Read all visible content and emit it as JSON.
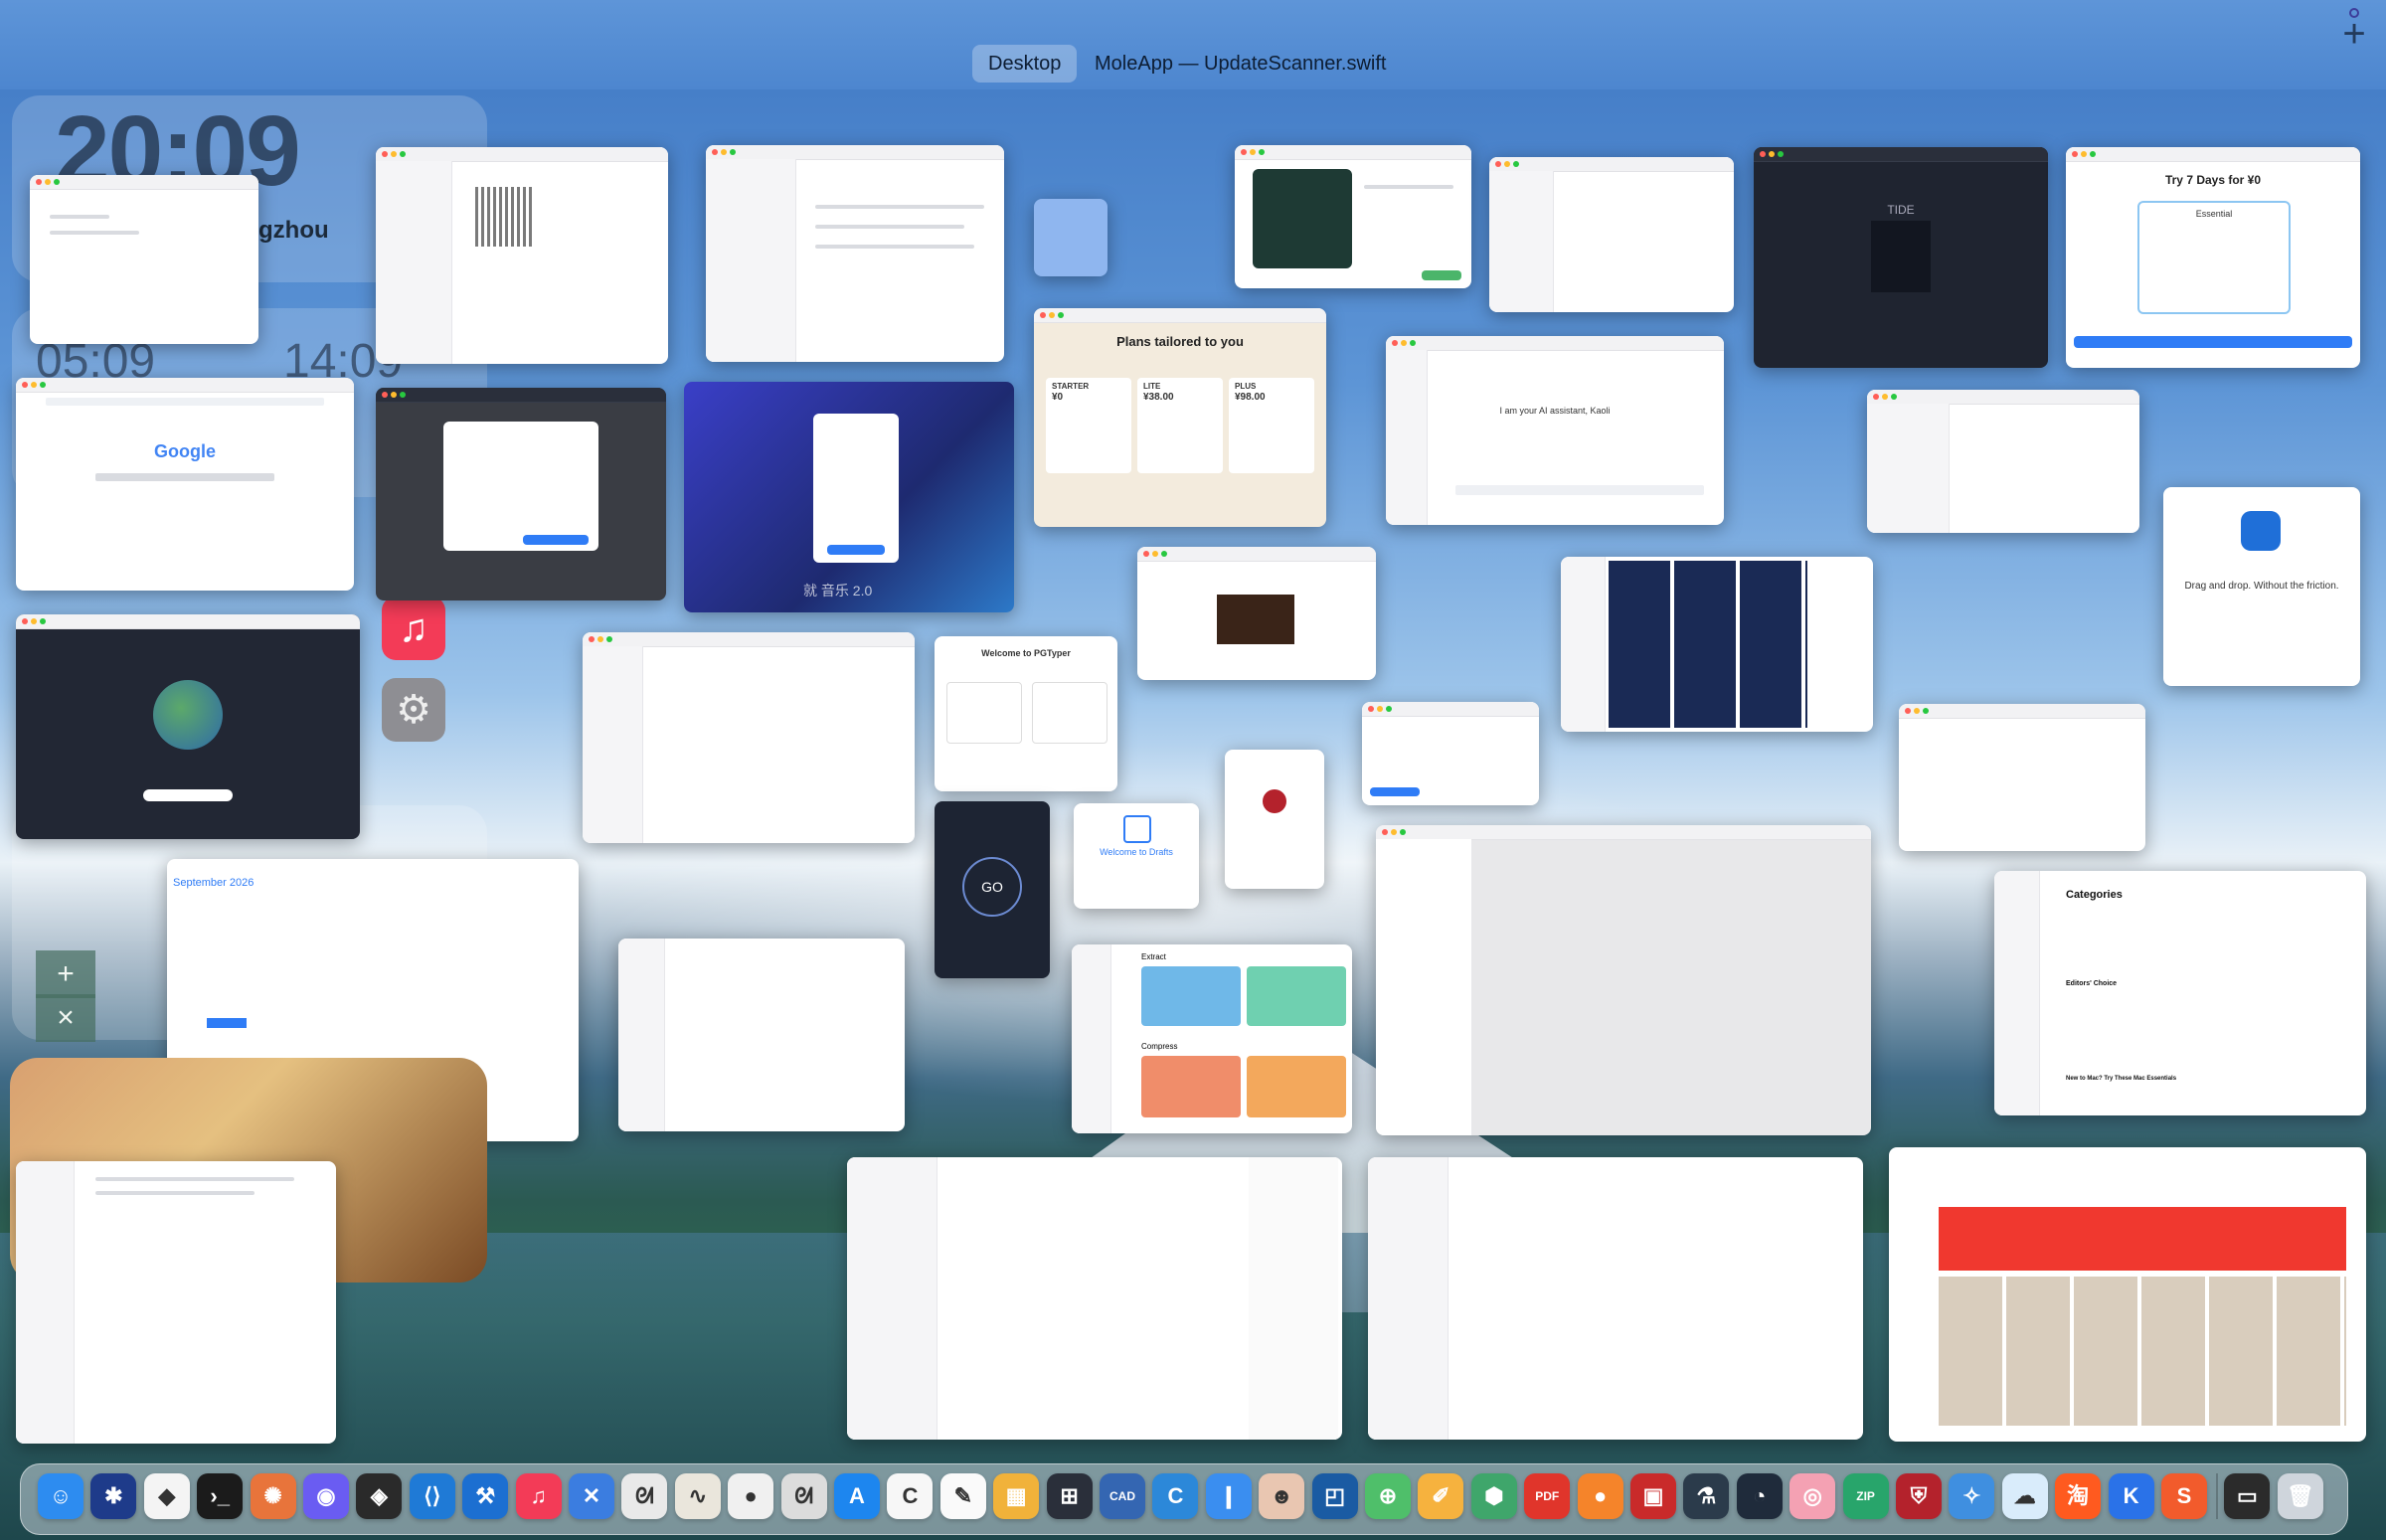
{
  "topbar": {
    "spaces": [
      "Desktop",
      "MoleApp — UpdateScanner.swift"
    ],
    "add_space_label": "+"
  },
  "widgets": {
    "clock_time": "20:09",
    "clock_city": "gzhou",
    "world_clock_1": "05:09",
    "world_clock_2": "14:09",
    "calculator_keys": [
      "+",
      "×"
    ]
  },
  "windows": {
    "google": {
      "logo_text": "Google"
    },
    "plans": {
      "title": "Plans tailored to you",
      "tiers": [
        "STARTER",
        "LITE",
        "PLUS"
      ],
      "prices": [
        "¥0",
        "¥38.00",
        "¥98.00"
      ]
    },
    "trial": {
      "title": "Try 7 Days for ¥0",
      "plan": "Essential"
    },
    "tide": {
      "title": "TIDE"
    },
    "dragdrop": {
      "title": "Drag and drop. Without the friction."
    },
    "assistant": {
      "greeting": "I am your AI assistant, Kaoli"
    },
    "postgres": {
      "title": "Welcome to PGTyper"
    },
    "drafts": {
      "title": "Welcome to Drafts"
    },
    "vpn": {
      "button": "GO"
    },
    "calendar": {
      "month": "September 2026"
    },
    "categories": {
      "title": "Categories",
      "section_1": "Editors' Choice",
      "section_2": "New to Mac? Try These Mac Essentials"
    },
    "compress": {
      "section_1": "Extract",
      "section_2": "Compress"
    },
    "music_logo": "就 音乐 2.0"
  },
  "dock": {
    "icons": [
      {
        "name": "finder-icon",
        "color": "#2d8cf0",
        "glyph": "☺"
      },
      {
        "name": "asterisk-icon",
        "color": "#1e3b8a",
        "glyph": "✱"
      },
      {
        "name": "cardinal-icon",
        "color": "#f4f4f4",
        "glyph": "◆"
      },
      {
        "name": "terminal-icon",
        "color": "#1b1b1b",
        "glyph": "›_"
      },
      {
        "name": "claude-icon",
        "color": "#e8743b",
        "glyph": "✺"
      },
      {
        "name": "chat-icon",
        "color": "#6a5cf2",
        "glyph": "◉"
      },
      {
        "name": "cube-icon",
        "color": "#2a2a2a",
        "glyph": "◈"
      },
      {
        "name": "vscode-icon",
        "color": "#1f7ad6",
        "glyph": "⟨⟩"
      },
      {
        "name": "xcode-icon",
        "color": "#1c6fd1",
        "glyph": "⚒"
      },
      {
        "name": "music-icon",
        "color": "#f33b57",
        "glyph": "♫"
      },
      {
        "name": "xcode-tools-icon",
        "color": "#3b7de0",
        "glyph": "✕"
      },
      {
        "name": "rabbit-icon",
        "color": "#e9e9e9",
        "glyph": "ᘛ"
      },
      {
        "name": "lizard-icon",
        "color": "#eae6dc",
        "glyph": "∿"
      },
      {
        "name": "panda-icon",
        "color": "#f0f0f0",
        "glyph": "●"
      },
      {
        "name": "rabbit2-icon",
        "color": "#dcdcdc",
        "glyph": "ᘛ"
      },
      {
        "name": "app-store-icon",
        "color": "#1d86ef",
        "glyph": "A"
      },
      {
        "name": "cleanmaster-icon",
        "color": "#f7f7f7",
        "glyph": "C"
      },
      {
        "name": "notes-icon",
        "color": "#fafafa",
        "glyph": "✎"
      },
      {
        "name": "picture-icon",
        "color": "#f1b23a",
        "glyph": "▦"
      },
      {
        "name": "grid-icon",
        "color": "#2a2f3a",
        "glyph": "⊞"
      },
      {
        "name": "cad-icon",
        "color": "#3466b2",
        "glyph": "CAD"
      },
      {
        "name": "crayon-icon",
        "color": "#2c88d9",
        "glyph": "C"
      },
      {
        "name": "bookmark-icon",
        "color": "#3a8ef0",
        "glyph": "❙"
      },
      {
        "name": "avatar-icon",
        "color": "#e9c6b1",
        "glyph": "☻"
      },
      {
        "name": "frame-icon",
        "color": "#1a5ba3",
        "glyph": "◰"
      },
      {
        "name": "maps-icon",
        "color": "#4fbf6a",
        "glyph": "⊕"
      },
      {
        "name": "sketch-icon",
        "color": "#f6b23e",
        "glyph": "✐"
      },
      {
        "name": "shield-green-icon",
        "color": "#3fa66b",
        "glyph": "⬢"
      },
      {
        "name": "pdf-icon",
        "color": "#e0352b",
        "glyph": "PDF"
      },
      {
        "name": "color-ball-icon",
        "color": "#f5842a",
        "glyph": "●"
      },
      {
        "name": "redbook-icon",
        "color": "#c92a2a",
        "glyph": "▣"
      },
      {
        "name": "flask-icon",
        "color": "#2b3b4b",
        "glyph": "⚗"
      },
      {
        "name": "gauge-icon",
        "color": "#1f2b3b",
        "glyph": "◔"
      },
      {
        "name": "donut-icon",
        "color": "#f4a1b3",
        "glyph": "◎"
      },
      {
        "name": "zip-icon",
        "color": "#28a56b",
        "glyph": "ZIP"
      },
      {
        "name": "shield-red-icon",
        "color": "#b4222c",
        "glyph": "⛨"
      },
      {
        "name": "bird-icon",
        "color": "#3f8fe0",
        "glyph": "✧"
      },
      {
        "name": "cloud-icon",
        "color": "#d9ecfb",
        "glyph": "☁"
      },
      {
        "name": "taobao-icon",
        "color": "#ff5a1f",
        "glyph": "淘"
      },
      {
        "name": "k-icon",
        "color": "#2a72e8",
        "glyph": "K"
      },
      {
        "name": "s-icon",
        "color": "#f25b2c",
        "glyph": "S"
      },
      {
        "name": "screen-icon",
        "color": "#2b2b2b",
        "glyph": "▭"
      },
      {
        "name": "trash-icon",
        "color": "#cfd5dc",
        "glyph": "🗑"
      }
    ]
  }
}
